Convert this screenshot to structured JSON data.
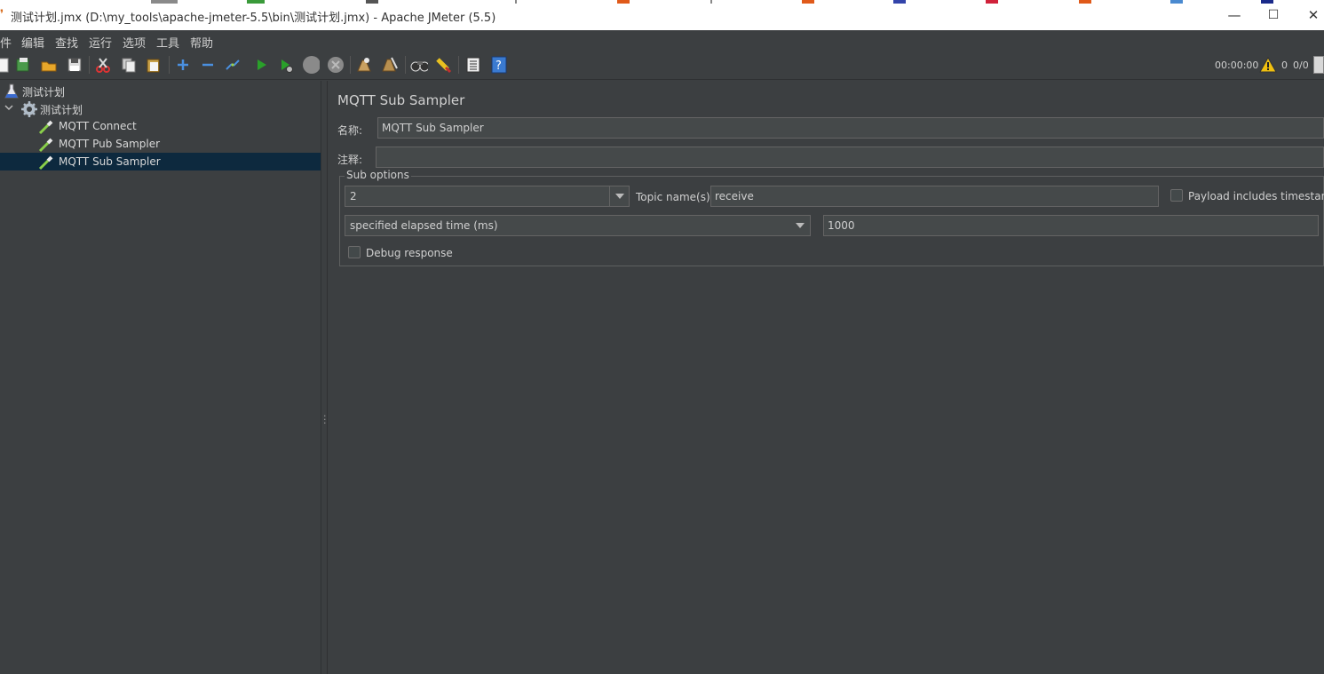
{
  "window": {
    "title": "测试计划.jmx (D:\\my_tools\\apache-jmeter-5.5\\bin\\测试计划.jmx) - Apache JMeter (5.5)",
    "minimize_glyph": "—",
    "maximize_glyph": "☐",
    "close_glyph": "✕"
  },
  "menu": {
    "items": [
      "件",
      "编辑",
      "查找",
      "运行",
      "选项",
      "工具",
      "帮助"
    ]
  },
  "toolbar": {
    "icons": [
      "new-icon",
      "templates-icon",
      "open-icon",
      "save-icon",
      "cut-icon",
      "copy-icon",
      "paste-icon",
      "expand-icon",
      "collapse-icon",
      "toggle-icon",
      "start-icon",
      "start-no-pause-icon",
      "stop-icon",
      "shutdown-icon",
      "clear-icon",
      "clear-all-icon",
      "search-icon",
      "reset-search-icon",
      "function-helper-icon",
      "help-icon"
    ]
  },
  "status": {
    "elapsed_time": "00:00:00",
    "error_count": "0",
    "threads": "0/0"
  },
  "tree": {
    "items": [
      {
        "label": "测试计划",
        "icon": "flask-icon"
      },
      {
        "label": "测试计划",
        "icon": "gear-icon"
      },
      {
        "label": "MQTT Connect",
        "icon": "pipette-icon"
      },
      {
        "label": "MQTT Pub Sampler",
        "icon": "pipette-icon"
      },
      {
        "label": "MQTT Sub Sampler",
        "icon": "pipette-icon"
      }
    ]
  },
  "panel": {
    "title": "MQTT Sub Sampler",
    "name_label": "名称:",
    "name_value": "MQTT Sub Sampler",
    "comment_label": "注释:",
    "comment_value": "",
    "sub_options": {
      "legend": "Sub options",
      "qos_value": "2",
      "topic_label": "Topic name(s):",
      "topic_value": "receive",
      "payload_timestamp_label": "Payload includes timestamp",
      "sample_on_value": "specified elapsed time (ms)",
      "elapsed_value": "1000",
      "debug_label": "Debug response"
    }
  },
  "colors": {
    "background": "#3c3f41",
    "selected_row": "#0d293e",
    "input_bg": "#45494a"
  }
}
